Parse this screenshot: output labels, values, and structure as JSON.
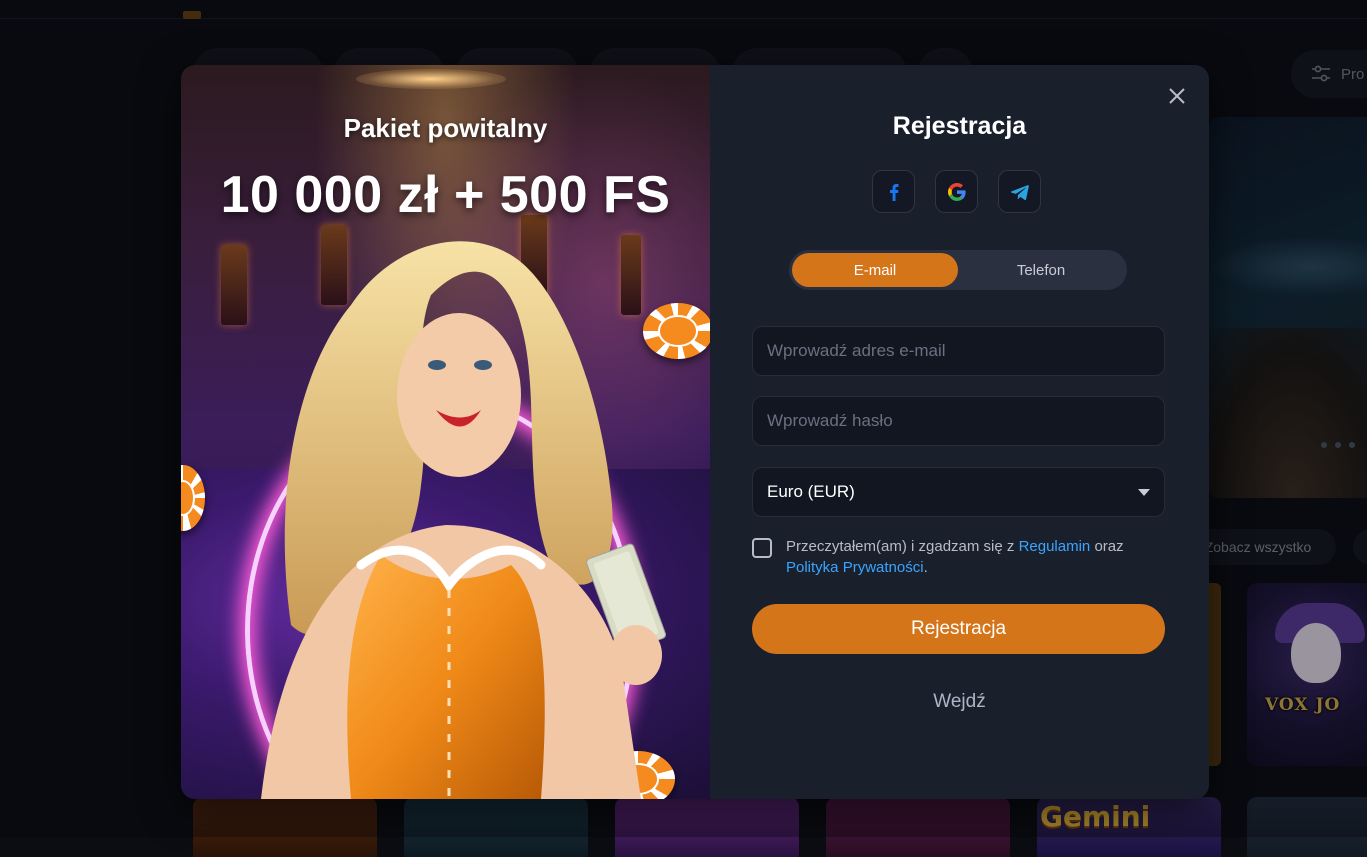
{
  "background": {
    "filter_button_label": "Pro",
    "see_all_label": "Zobacz wszystko",
    "game_card_title": "VOX JO",
    "bottom_card_title": "Gemini"
  },
  "promo": {
    "subtitle": "Pakiet powitalny",
    "title": "10 000 zł + 500 FS"
  },
  "registration": {
    "title": "Rejestracja",
    "socials": [
      {
        "icon": "facebook-icon",
        "color": "#1877f2"
      },
      {
        "icon": "google-icon",
        "color": "#ea4335"
      },
      {
        "icon": "telegram-icon",
        "color": "#2aa3df"
      }
    ],
    "tabs": [
      {
        "label": "E-mail",
        "active": true
      },
      {
        "label": "Telefon",
        "active": false
      }
    ],
    "email_placeholder": "Wprowadź adres e-mail",
    "password_placeholder": "Wprowadź hasło",
    "currency_selected": "Euro (EUR)",
    "terms": {
      "prefix": "Przeczytałem(am) i zgadzam się z ",
      "terms_link": "Regulamin",
      "middle": " oraz ",
      "privacy_link": "Polityka Prywatności",
      "suffix": ".",
      "checked": false
    },
    "submit_label": "Rejestracja",
    "login_label": "Wejdź"
  },
  "colors": {
    "accent": "#d4751a",
    "link": "#3aa4ff",
    "panel": "#1a1f2c",
    "page": "#0b0d13"
  }
}
